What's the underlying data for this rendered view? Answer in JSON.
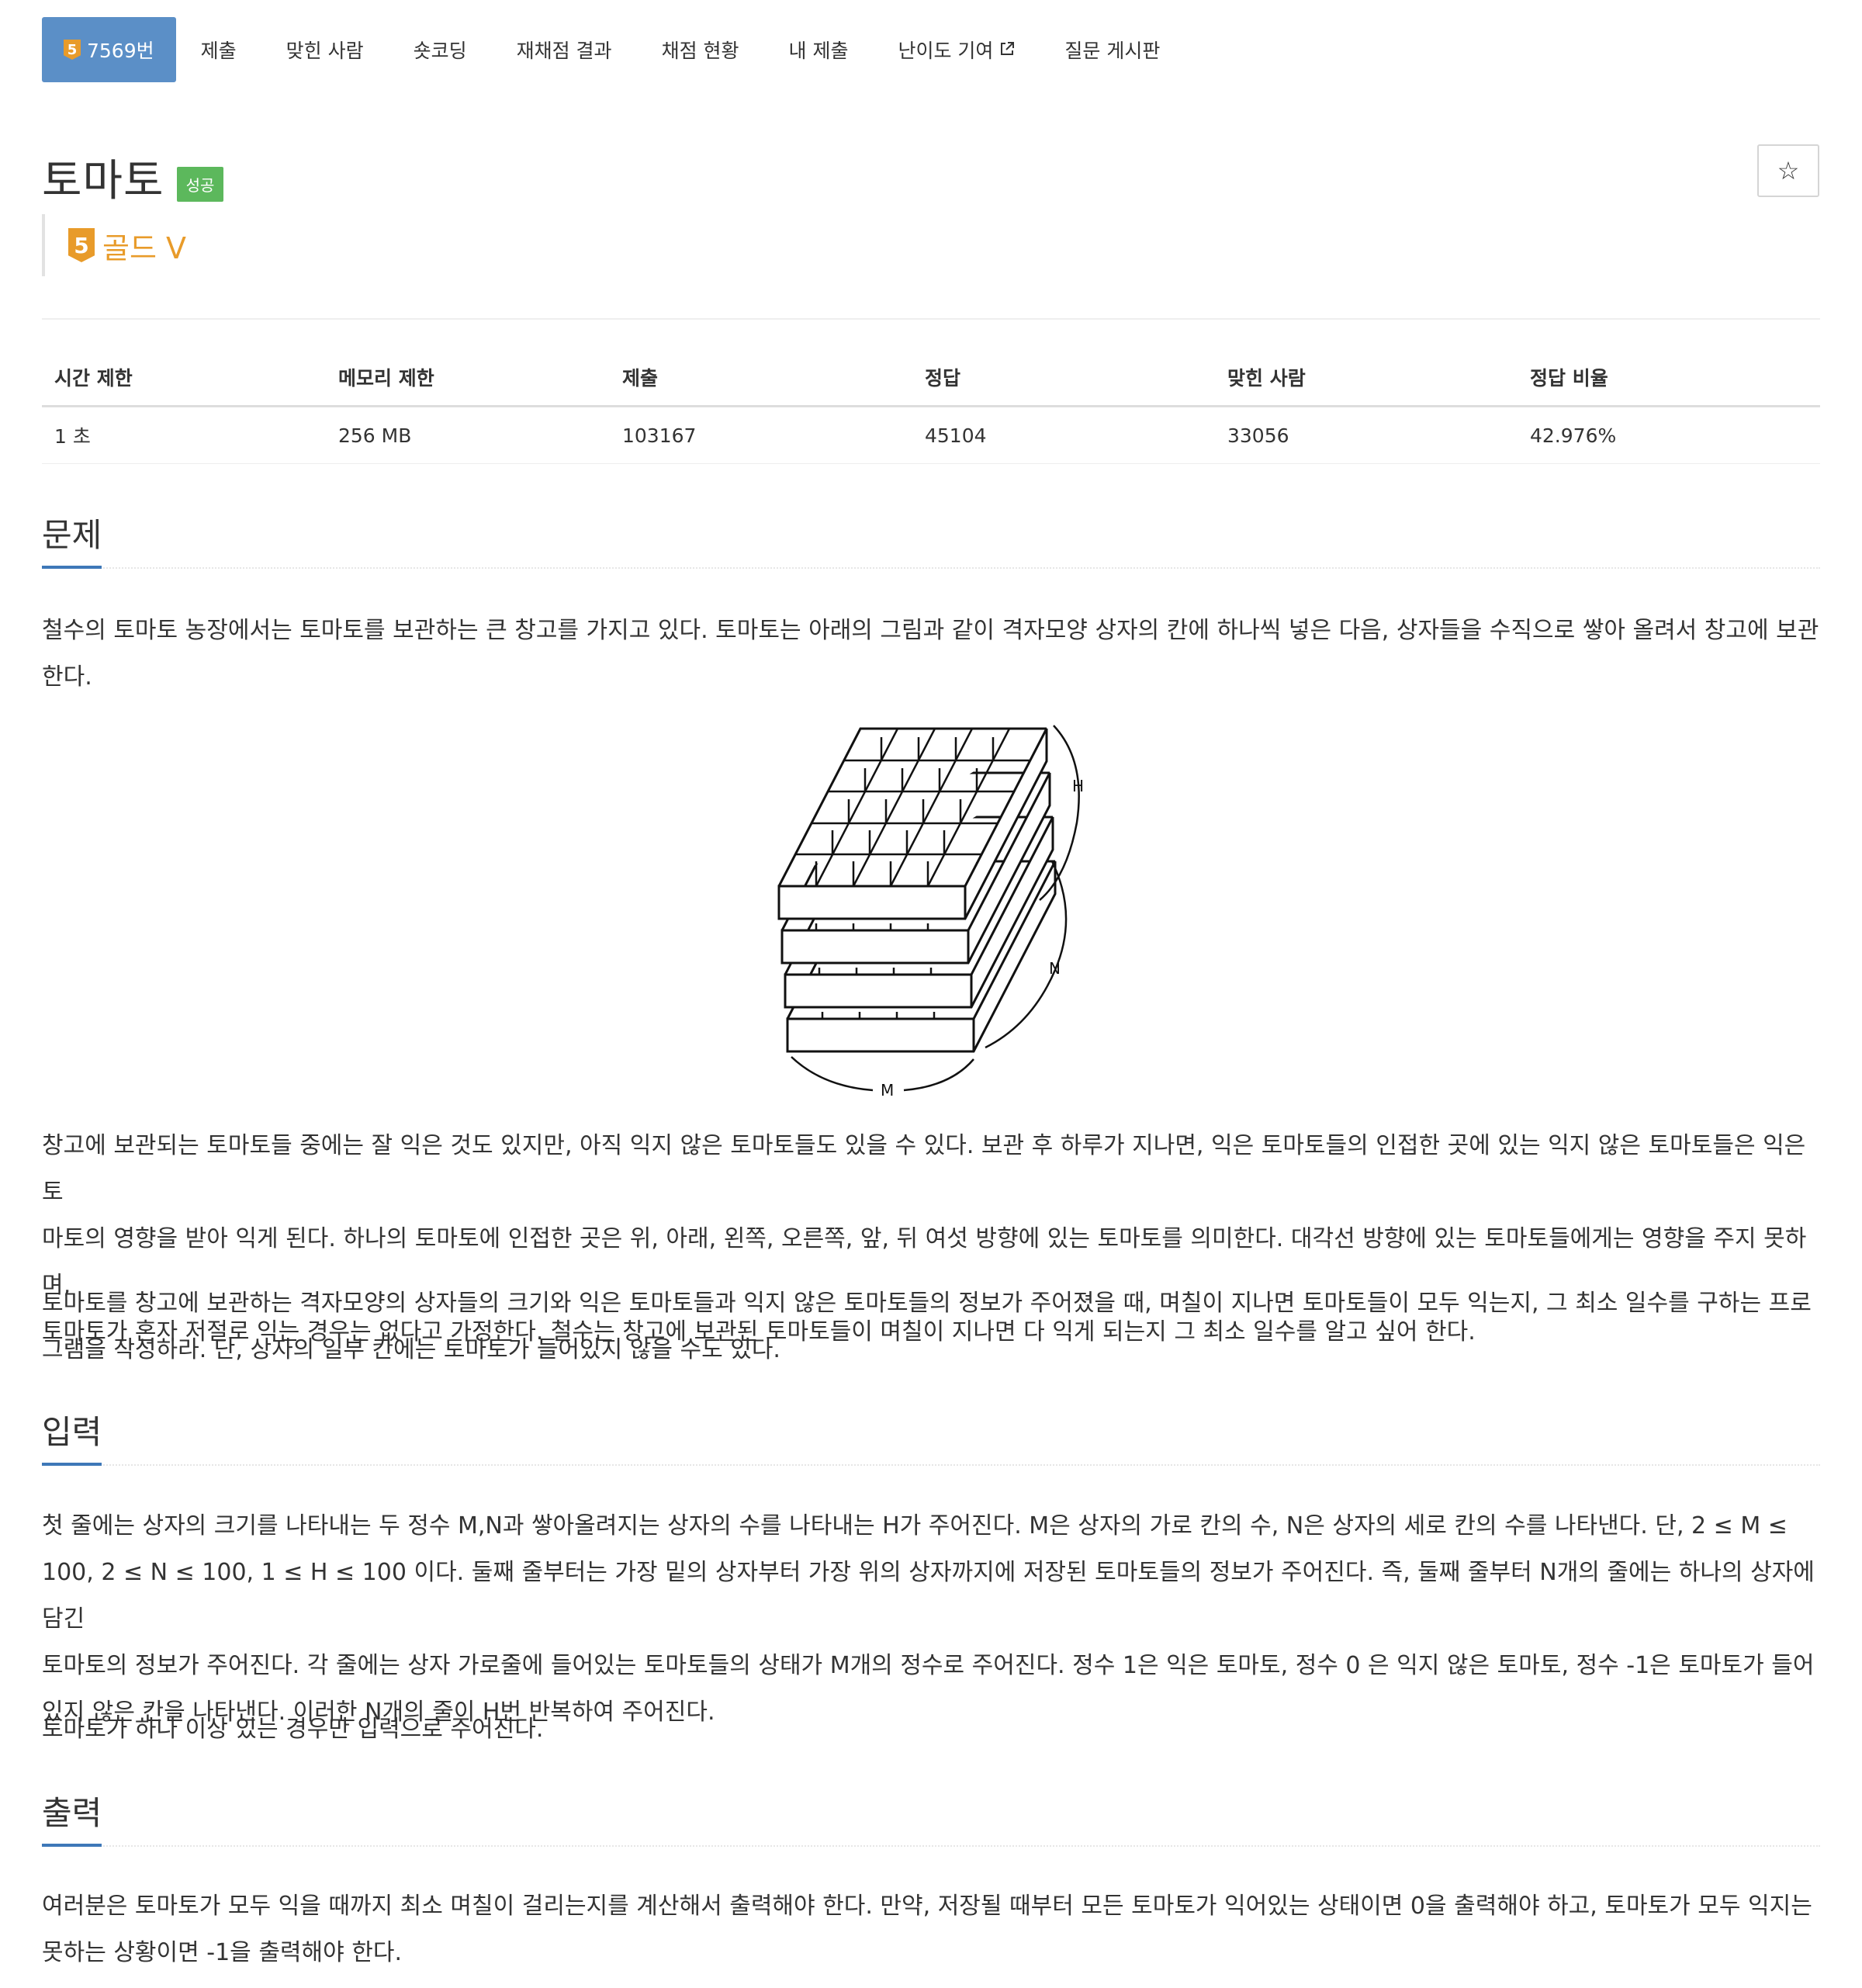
{
  "tabs": {
    "problem_number": "7569번",
    "tier_number": "5",
    "items": [
      "제출",
      "맞힌 사람",
      "숏코딩",
      "재채점 결과",
      "채점 현황",
      "내 제출",
      "난이도 기여",
      "질문 게시판"
    ],
    "external_link_icon": "external-link-icon"
  },
  "header": {
    "title": "토마토",
    "status": "성공",
    "status_color": "#5cb85c",
    "star_symbol": "☆",
    "tier_number": "5",
    "tier_label": "골드 V",
    "tier_color": "#e89b2a"
  },
  "info_table": {
    "headers": [
      "시간 제한",
      "메모리 제한",
      "제출",
      "정답",
      "맞힌 사람",
      "정답 비율"
    ],
    "values": [
      "1 초",
      "256 MB",
      "103167",
      "45104",
      "33056",
      "42.976%"
    ]
  },
  "sections": {
    "problem": {
      "heading": "문제",
      "p1": "철수의 토마토 농장에서는 토마토를 보관하는 큰 창고를 가지고 있다. 토마토는 아래의 그림과 같이 격자모양 상자의 칸에 하나씩 넣은 다음, 상자들을 수직으로 쌓아 올려서 창고에 보관\n한다.",
      "figure_labels": {
        "h": "H",
        "n": "N",
        "m": "M"
      },
      "p2": "창고에 보관되는 토마토들 중에는 잘 익은 것도 있지만, 아직 익지 않은 토마토들도 있을 수 있다. 보관 후 하루가 지나면, 익은 토마토들의 인접한 곳에 있는 익지 않은 토마토들은 익은 토\n마토의 영향을 받아 익게 된다. 하나의 토마토에 인접한 곳은 위, 아래, 왼쪽, 오른쪽, 앞, 뒤 여섯 방향에 있는 토마토를 의미한다. 대각선 방향에 있는 토마토들에게는 영향을 주지 못하며,\n토마토가 혼자 저절로 익는 경우는 없다고 가정한다. 철수는 창고에 보관된 토마토들이 며칠이 지나면 다 익게 되는지 그 최소 일수를 알고 싶어 한다.",
      "p3": "토마토를 창고에 보관하는 격자모양의 상자들의 크기와 익은 토마토들과 익지 않은 토마토들의 정보가 주어졌을 때, 며칠이 지나면 토마토들이 모두 익는지, 그 최소 일수를 구하는 프로\n그램을 작성하라. 단, 상자의 일부 칸에는 토마토가 들어있지 않을 수도 있다."
    },
    "input": {
      "heading": "입력",
      "p1": "첫 줄에는 상자의 크기를 나타내는 두 정수 M,N과 쌓아올려지는 상자의 수를 나타내는 H가 주어진다. M은 상자의 가로 칸의 수, N은 상자의 세로 칸의 수를 나타낸다. 단, 2 ≤ M ≤\n100, 2 ≤ N ≤ 100, 1 ≤ H ≤ 100 이다. 둘째 줄부터는 가장 밑의 상자부터 가장 위의 상자까지에 저장된 토마토들의 정보가 주어진다. 즉, 둘째 줄부터 N개의 줄에는 하나의 상자에 담긴\n토마토의 정보가 주어진다. 각 줄에는 상자 가로줄에 들어있는 토마토들의 상태가 M개의 정수로 주어진다. 정수 1은 익은 토마토, 정수 0 은 익지 않은 토마토, 정수 -1은 토마토가 들어\n있지 않은 칸을 나타낸다. 이러한 N개의 줄이 H번 반복하여 주어진다.",
      "p2": "토마토가 하나 이상 있는 경우만 입력으로 주어진다."
    },
    "output": {
      "heading": "출력",
      "p1": "여러분은 토마토가 모두 익을 때까지 최소 며칠이 걸리는지를 계산해서 출력해야 한다. 만약, 저장될 때부터 모든 토마토가 익어있는 상태이면 0을 출력해야 하고, 토마토가 모두 익지는\n못하는 상황이면 -1을 출력해야 한다."
    }
  },
  "colors": {
    "tab_active": "#5b8fc7",
    "heading_underline": "#3e78b8",
    "text": "#333333"
  }
}
